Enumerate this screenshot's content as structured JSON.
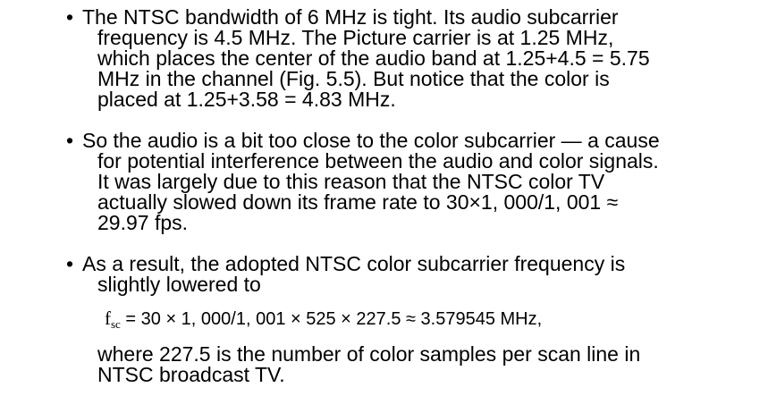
{
  "bullets": [
    {
      "lines": [
        "The NTSC bandwidth of 6 MHz is tight. Its audio subcarrier",
        "frequency is 4.5 MHz. The Picture carrier is at 1.25 MHz,",
        "which places the center of the audio band at 1.25+4.5 = 5.75",
        "MHz in the channel (Fig. 5.5). But notice that the color is",
        "placed at 1.25+3.58 = 4.83 MHz."
      ]
    },
    {
      "lines": [
        "So the audio is a bit too close to the color subcarrier — a cause",
        "for potential interference between the audio and color signals.",
        "It was largely due to this reason that the NTSC color TV",
        "actually slowed down its frame rate to 30×1, 000/1, 001 ≈",
        "29.97 fps."
      ]
    },
    {
      "lines": [
        "As a result, the adopted NTSC color subcarrier frequency is",
        "slightly lowered to"
      ]
    }
  ],
  "bullet_symbol": "•",
  "formula": {
    "symbol": "f",
    "subscript": "sc",
    "expression": "= 30 × 1, 000/1, 001 × 525 × 227.5 ≈ 3.579545 MHz,"
  },
  "after_formula": [
    "where 227.5 is the number of color samples per scan line in",
    "NTSC broadcast TV."
  ]
}
